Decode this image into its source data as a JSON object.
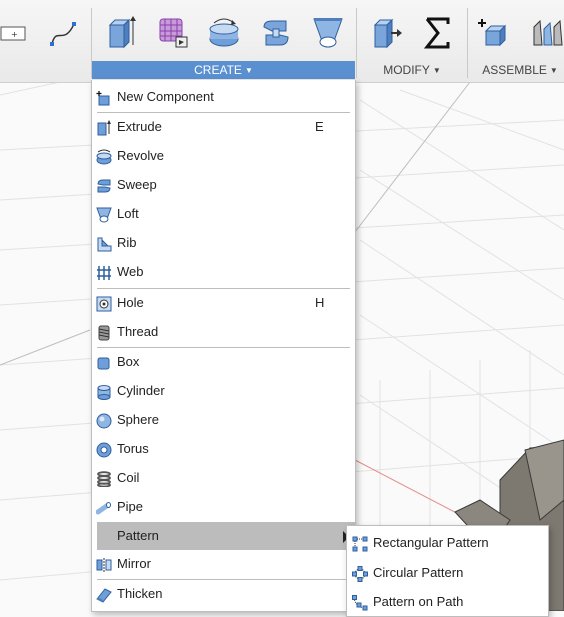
{
  "toolbar": {
    "groups": [
      {
        "label": "CREATE"
      },
      {
        "label": "MODIFY"
      },
      {
        "label": "ASSEMBLE"
      }
    ]
  },
  "create_menu": {
    "items": [
      {
        "label": "New Component",
        "shortcut": ""
      },
      {
        "label": "Extrude",
        "shortcut": "E"
      },
      {
        "label": "Revolve",
        "shortcut": ""
      },
      {
        "label": "Sweep",
        "shortcut": ""
      },
      {
        "label": "Loft",
        "shortcut": ""
      },
      {
        "label": "Rib",
        "shortcut": ""
      },
      {
        "label": "Web",
        "shortcut": ""
      },
      {
        "label": "Hole",
        "shortcut": "H"
      },
      {
        "label": "Thread",
        "shortcut": ""
      },
      {
        "label": "Box",
        "shortcut": ""
      },
      {
        "label": "Cylinder",
        "shortcut": ""
      },
      {
        "label": "Sphere",
        "shortcut": ""
      },
      {
        "label": "Torus",
        "shortcut": ""
      },
      {
        "label": "Coil",
        "shortcut": ""
      },
      {
        "label": "Pipe",
        "shortcut": ""
      },
      {
        "label": "Pattern",
        "shortcut": ""
      },
      {
        "label": "Mirror",
        "shortcut": ""
      },
      {
        "label": "Thicken",
        "shortcut": ""
      }
    ]
  },
  "pattern_submenu": {
    "items": [
      {
        "label": "Rectangular Pattern"
      },
      {
        "label": "Circular Pattern"
      },
      {
        "label": "Pattern on Path"
      }
    ]
  },
  "colors": {
    "accent": "#5a8fd0",
    "highlight": "#bcbcbc",
    "icon_blue": "#6f9fd8"
  }
}
